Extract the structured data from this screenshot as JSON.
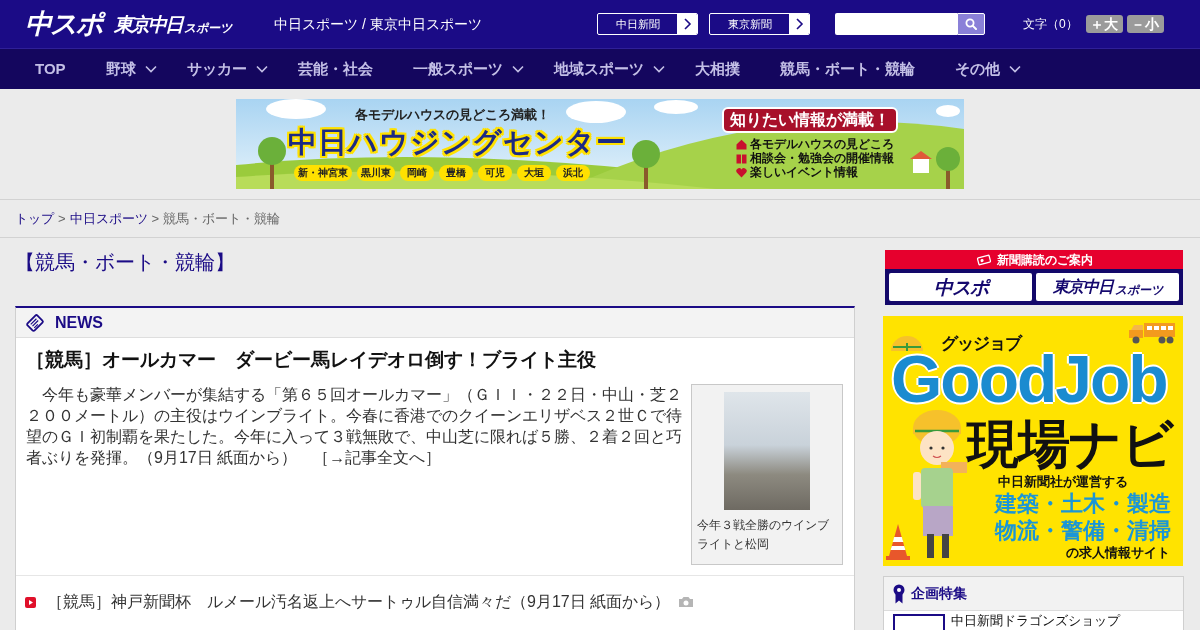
{
  "header": {
    "logos": [
      {
        "kind": "main",
        "text": "中スポ"
      },
      {
        "kind": "tokyo",
        "text": "東京中日",
        "suffix": "スポーツ"
      }
    ],
    "site_title": "中日スポーツ / 東京中日スポーツ",
    "paper_links": [
      {
        "label": "中日新聞"
      },
      {
        "label": "東京新聞"
      }
    ],
    "font_size": {
      "label": "文字（0）",
      "buttons": [
        "＋大",
        "－小"
      ]
    }
  },
  "nav": [
    {
      "label": "TOP",
      "has_menu": false
    },
    {
      "label": "野球",
      "has_menu": true
    },
    {
      "label": "サッカー",
      "has_menu": true
    },
    {
      "label": "芸能・社会",
      "has_menu": false
    },
    {
      "label": "一般スポーツ",
      "has_menu": true
    },
    {
      "label": "地域スポーツ",
      "has_menu": true
    },
    {
      "label": "大相撲",
      "has_menu": false
    },
    {
      "label": "競馬・ボート・競輪",
      "has_menu": false
    },
    {
      "label": "その他",
      "has_menu": true
    }
  ],
  "top_ad": {
    "tagline": "各モデルハウスの見どころ満載！",
    "title": "中日ハウジングセンター",
    "locations": [
      "新・神宮東",
      "黒川東",
      "岡崎",
      "豊橋",
      "可児",
      "大垣",
      "浜北"
    ],
    "headline": "知りたい情報が満載！",
    "points": [
      "各モデルハウスの見どころ",
      "相談会・勉強会の開催情報",
      "楽しいイベント情報"
    ]
  },
  "breadcrumb": [
    {
      "kind": "link",
      "label": "トップ"
    },
    {
      "kind": "separator",
      "label": ">"
    },
    {
      "kind": "link",
      "label": "中日スポーツ"
    },
    {
      "kind": "separator",
      "label": ">"
    },
    {
      "kind": "current",
      "label": "競馬・ボート・競輪"
    }
  ],
  "page_title": "【競馬・ボート・競輪】",
  "news": {
    "heading": "NEWS",
    "lead": {
      "headline": "［競馬］オールカマー　ダービー馬レイデオロ倒す！ブライト主役",
      "summary": "今年も豪華メンバーが集結する「第６５回オールカマー」（ＧＩＩ・２２日・中山・芝２２００メートル）の主役はウインブライト。今春に香港でのクイーンエリザベス２世Ｃで待望のＧＩ初制覇を果たした。今年に入って３戦無敗で、中山芝に限れば５勝、２着２回と巧者ぶりを発揮。",
      "source": "（9月17日 紙面から）",
      "more_link": "［→記事全文へ］",
      "photo_caption": "今年３戦全勝のウインブライトと松岡"
    },
    "items": [
      {
        "title": "［競馬］神戸新聞杯　ルメール汚名返上へサートゥル自信満々だ",
        "source": "（9月17日 紙面から）",
        "has_photo": true
      }
    ]
  },
  "subscription": {
    "title": "新聞購読のご案内",
    "papers": [
      {
        "kind": "main",
        "text": "中スポ"
      },
      {
        "kind": "tokyo",
        "text": "東京中日",
        "suffix": "スポーツ"
      }
    ]
  },
  "side_ad": {
    "kicker": "グッジョブ",
    "brand": "GoodJob",
    "title": "現場ナビ",
    "operator": "中日新聞社が運営する",
    "fields": [
      "建築・土木・製造",
      "物流・警備・清掃"
    ],
    "tail": "の求人情報サイト"
  },
  "features": {
    "heading": "企画特集",
    "items": [
      {
        "title": "中日新聞ドラゴンズショップ"
      }
    ]
  }
}
